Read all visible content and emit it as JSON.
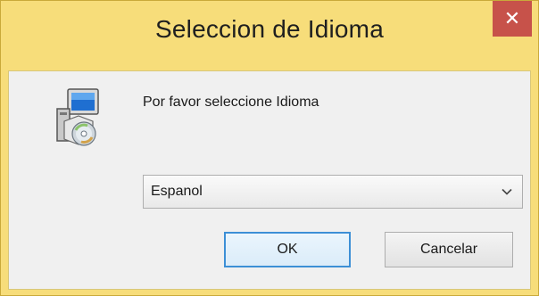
{
  "window": {
    "title": "Seleccion de Idioma",
    "close_label": "✕"
  },
  "dialog": {
    "prompt": "Por favor seleccione Idioma",
    "language_select": {
      "selected": "Espanol"
    },
    "ok_label": "OK",
    "cancel_label": "Cancelar"
  },
  "colors": {
    "titlebar": "#f7dd7a",
    "close_button": "#c7524a",
    "client": "#f0f0f0",
    "default_button_border": "#3c8fd6"
  },
  "icons": {
    "app": "installer-icon",
    "dropdown": "chevron-down-icon"
  }
}
